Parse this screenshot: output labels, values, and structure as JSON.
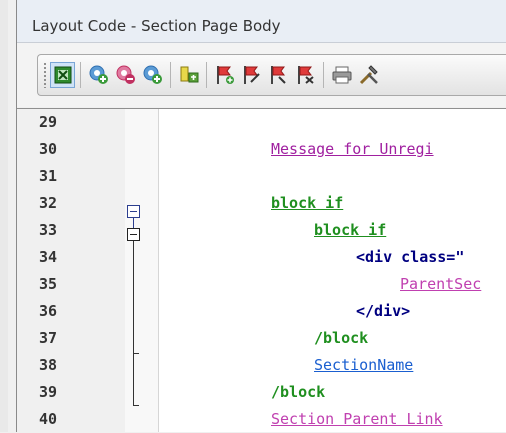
{
  "window": {
    "title": "Layout Code  - Section Page Body"
  },
  "toolbar": {
    "buttons": [
      {
        "icon": "frame-icon",
        "color": "#2e8a2e"
      },
      {
        "icon": "add-code-icon",
        "color": "#2f6fb0"
      },
      {
        "icon": "remove-code-icon",
        "color": "#c03060"
      },
      {
        "icon": "edit-code-icon",
        "color": "#2f6fb0"
      },
      {
        "icon": "insert-icon",
        "color": "#6a8a1a"
      },
      {
        "icon": "flag-add-icon",
        "color": "#d03030"
      },
      {
        "icon": "flag-edit-icon",
        "color": "#d03030"
      },
      {
        "icon": "flag-icon",
        "color": "#d03030"
      },
      {
        "icon": "flag-remove-icon",
        "color": "#d03030"
      },
      {
        "icon": "print-icon",
        "color": "#555555"
      },
      {
        "icon": "tools-icon",
        "color": "#6b5a2e"
      }
    ]
  },
  "editor": {
    "lines": [
      {
        "number": "29",
        "indent": "",
        "text": "",
        "style": "none"
      },
      {
        "number": "30",
        "indent": "",
        "text": "Message for Unregi",
        "style": "purple"
      },
      {
        "number": "31",
        "indent": "",
        "text": "",
        "style": "none"
      },
      {
        "number": "32",
        "indent": "",
        "text": "block if",
        "style": "green"
      },
      {
        "number": "33",
        "indent": "   ",
        "text": "block if",
        "style": "green"
      },
      {
        "number": "34",
        "indent": "      ",
        "text": "<div class=\"",
        "style": "navy"
      },
      {
        "number": "35",
        "indent": "         ",
        "text": "ParentSec",
        "style": "pink"
      },
      {
        "number": "36",
        "indent": "      ",
        "text": "</div>",
        "style": "navy"
      },
      {
        "number": "37",
        "indent": "   ",
        "text": "/block",
        "style": "green2"
      },
      {
        "number": "38",
        "indent": "   ",
        "text": "SectionName",
        "style": "blue"
      },
      {
        "number": "39",
        "indent": "",
        "text": "/block",
        "style": "green2"
      },
      {
        "number": "40",
        "indent": "",
        "text": "Section Parent Link",
        "style": "pink"
      }
    ]
  }
}
